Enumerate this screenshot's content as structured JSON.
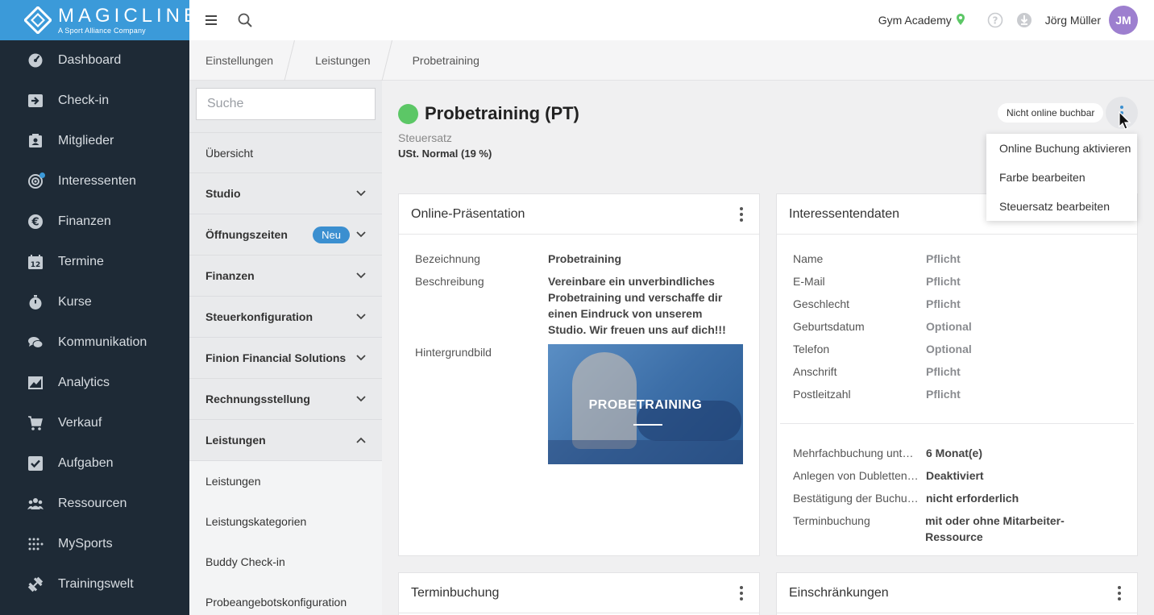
{
  "logo": {
    "brand": "MAGICLINE",
    "tagline": "A Sport Alliance Company"
  },
  "nav": [
    {
      "label": "Dashboard",
      "icon": "dashboard-icon"
    },
    {
      "label": "Check-in",
      "icon": "checkin-icon"
    },
    {
      "label": "Mitglieder",
      "icon": "members-icon"
    },
    {
      "label": "Interessenten",
      "icon": "prospects-icon"
    },
    {
      "label": "Finanzen",
      "icon": "euro-icon"
    },
    {
      "label": "Termine",
      "icon": "calendar-icon"
    },
    {
      "label": "Kurse",
      "icon": "stopwatch-icon"
    },
    {
      "label": "Kommunikation",
      "icon": "chat-icon"
    },
    {
      "label": "Analytics",
      "icon": "chart-icon"
    },
    {
      "label": "Verkauf",
      "icon": "cart-icon"
    },
    {
      "label": "Aufgaben",
      "icon": "checkbox-icon"
    },
    {
      "label": "Ressourcen",
      "icon": "group-icon"
    },
    {
      "label": "MySports",
      "icon": "dots-grid-icon"
    },
    {
      "label": "Trainingswelt",
      "icon": "dumbbell-icon"
    }
  ],
  "topbar": {
    "studio": "Gym Academy",
    "user": "Jörg Müller",
    "initials": "JM"
  },
  "breadcrumb": [
    "Einstellungen",
    "Leistungen",
    "Probetraining"
  ],
  "settings": {
    "search_placeholder": "Suche",
    "items": [
      {
        "label": "Übersicht"
      },
      {
        "label": "Studio"
      },
      {
        "label": "Öffnungszeiten",
        "badge": "Neu"
      },
      {
        "label": "Finanzen"
      },
      {
        "label": "Steuerkonfiguration"
      },
      {
        "label": "Finion Financial Solutions"
      },
      {
        "label": "Rechnungsstellung"
      },
      {
        "label": "Leistungen"
      }
    ],
    "sub_items": [
      "Leistungen",
      "Leistungskategorien",
      "Buddy Check-in",
      "Probeangebotskonfiguration"
    ]
  },
  "main": {
    "title": "Probetraining (PT)",
    "status_color": "#5cc766",
    "tax_label": "Steuersatz",
    "tax_value": "USt. Normal (19 %)",
    "online_status": "Nicht online buchbar",
    "menu": [
      "Online Buchung aktivieren",
      "Farbe bearbeiten",
      "Steuersatz bearbeiten"
    ]
  },
  "presentation": {
    "title": "Online-Präsentation",
    "name_label": "Bezeichnung",
    "name_value": "Probetraining",
    "desc_label": "Beschreibung",
    "desc_value": "Vereinbare ein unverbindliches Probetraining und verschaffe dir einen Eindruck von unserem Studio. Wir freuen uns auf dich!!!",
    "image_label": "Hintergrundbild",
    "image_text": "PROBETRAINING"
  },
  "prospect": {
    "title": "Interessentendaten",
    "fields": [
      {
        "k": "Name",
        "v": "Pflicht"
      },
      {
        "k": "E-Mail",
        "v": "Pflicht"
      },
      {
        "k": "Geschlecht",
        "v": "Pflicht"
      },
      {
        "k": "Geburtsdatum",
        "v": "Optional"
      },
      {
        "k": "Telefon",
        "v": "Optional"
      },
      {
        "k": "Anschrift",
        "v": "Pflicht"
      },
      {
        "k": "Postleitzahl",
        "v": "Pflicht"
      }
    ],
    "extra": [
      {
        "k": "Mehrfachbuchung unte…",
        "v": "6 Monat(e)"
      },
      {
        "k": "Anlegen von Dubletten …",
        "v": "Deaktiviert"
      },
      {
        "k": "Bestätigung der Buchung",
        "v": "nicht erforderlich"
      },
      {
        "k": "Terminbuchung",
        "v": "mit oder ohne Mitarbeiter-Ressource"
      }
    ]
  },
  "booking_card": {
    "title": "Terminbuchung"
  },
  "restrictions_card": {
    "title": "Einschränkungen"
  }
}
